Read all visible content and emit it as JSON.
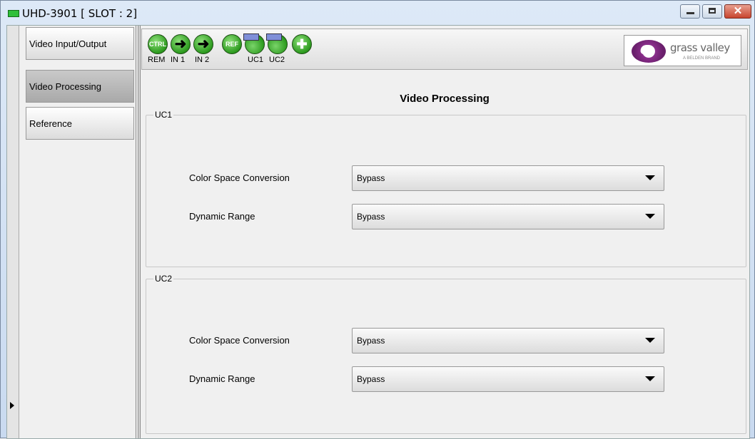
{
  "window": {
    "title": "UHD-3901 [ SLOT : 2]",
    "close_glyph": "✕"
  },
  "nav": {
    "items": [
      {
        "label": "Video Input/Output"
      },
      {
        "label": "Video Processing"
      },
      {
        "label": "Reference"
      }
    ]
  },
  "toolbar": {
    "icons": [
      {
        "text": "CTRL",
        "label": "REM"
      },
      {
        "text": "➜",
        "label": "IN 1"
      },
      {
        "text": "➜",
        "label": "IN 2"
      },
      {
        "text": "REF",
        "label": ""
      },
      {
        "text": "",
        "label": "UC1"
      },
      {
        "text": "",
        "label": "UC2"
      },
      {
        "text": "✚",
        "label": ""
      }
    ]
  },
  "logo": {
    "mark": "G",
    "name": "grass valley",
    "tagline": "A BELDEN BRAND"
  },
  "main": {
    "title": "Video Processing",
    "groups": [
      {
        "title": "UC1",
        "rows": [
          {
            "label": "Color Space Conversion",
            "value": "Bypass"
          },
          {
            "label": "Dynamic Range",
            "value": "Bypass"
          }
        ]
      },
      {
        "title": "UC2",
        "rows": [
          {
            "label": "Color Space Conversion",
            "value": "Bypass"
          },
          {
            "label": "Dynamic Range",
            "value": "Bypass"
          }
        ]
      }
    ]
  },
  "colors": {
    "status_green": "#2c9a1e",
    "brand_purple": "#8b2f8c",
    "active_tab": "#b0b0b0"
  }
}
